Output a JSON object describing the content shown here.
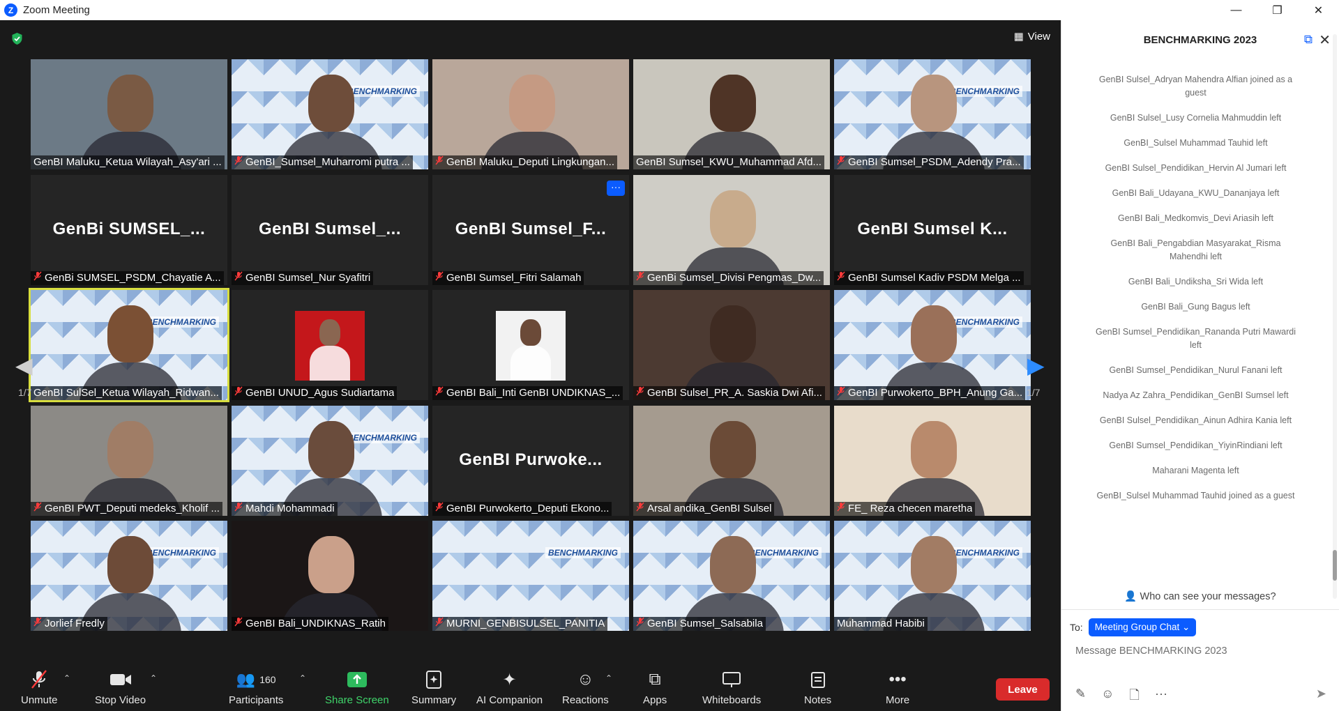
{
  "window": {
    "title": "Zoom Meeting",
    "minimize": "—",
    "restore": "❐",
    "close": "✕"
  },
  "view_label": "View",
  "pagination": {
    "left": "1/7",
    "right": "1/7"
  },
  "tiles": [
    {
      "name": "GenBI Maluku_Ketua Wilayah_Asy'ari ...",
      "muted": false,
      "kind": "video",
      "bg": "#6c7a86",
      "skin": "#7a5a44"
    },
    {
      "name": "GenBI_Sumsel_Muharromi putra ...",
      "muted": true,
      "kind": "banner",
      "skin": "#6e4d3a"
    },
    {
      "name": "GenBI Maluku_Deputi Lingkungan...",
      "muted": true,
      "kind": "video",
      "bg": "#b9a79a",
      "skin": "#c59a83"
    },
    {
      "name": "GenBI Sumsel_KWU_Muhammad Afd...",
      "muted": false,
      "kind": "video",
      "bg": "#c9c6bd",
      "skin": "#4f3426"
    },
    {
      "name": "GenBI Sumsel_PSDM_Adendy Pra...",
      "muted": true,
      "kind": "banner",
      "skin": "#b8957e"
    },
    {
      "name": "GenBi SUMSEL_PSDM_Chayatie A...",
      "muted": true,
      "kind": "name",
      "big": "GenBi  SUMSEL_..."
    },
    {
      "name": "GenBI Sumsel_Nur Syafitri",
      "muted": true,
      "kind": "name",
      "big": "GenBI  Sumsel_..."
    },
    {
      "name": "GenBI Sumsel_Fitri Salamah",
      "muted": true,
      "kind": "name",
      "big": "GenBI  Sumsel_F...",
      "dots": "···"
    },
    {
      "name": "GenBi Sumsel_Divisi Pengmas_Dw...",
      "muted": true,
      "kind": "video",
      "bg": "#cfcdc6",
      "skin": "#c8ab8c"
    },
    {
      "name": "GenBI Sumsel Kadiv PSDM Melga ...",
      "muted": true,
      "kind": "name",
      "big": "GenBI  Sumsel  K..."
    },
    {
      "name": "GenBI SulSel_Ketua Wilayah_Ridwan...",
      "muted": false,
      "kind": "banner",
      "skin": "#7b5034",
      "active": true
    },
    {
      "name": "GenBI UNUD_Agus Sudiartama",
      "muted": true,
      "kind": "photo",
      "bg": "#c4171b",
      "skin": "#8a6651"
    },
    {
      "name": "GenBI Bali_Inti GenBI UNDIKNAS_...",
      "muted": true,
      "kind": "photo",
      "bg": "#f2f2f2",
      "skin": "#6b4a38"
    },
    {
      "name": "GenBI Sulsel_PR_A. Saskia Dwi Afi...",
      "muted": true,
      "kind": "video",
      "bg": "#4c3a32",
      "skin": "#3f2b22"
    },
    {
      "name": "GenBI Purwokerto_BPH_Anung Ga...",
      "muted": true,
      "kind": "banner",
      "skin": "#9a7059"
    },
    {
      "name": "GenBI PWT_Deputi medeks_Kholif ...",
      "muted": true,
      "kind": "video",
      "bg": "#8c8a86",
      "skin": "#a07d66"
    },
    {
      "name": "Mahdi Mohammadi",
      "muted": true,
      "kind": "banner",
      "skin": "#6a4c3c"
    },
    {
      "name": "GenBI Purwokerto_Deputi Ekono...",
      "muted": true,
      "kind": "name",
      "big": "GenBI  Purwoke..."
    },
    {
      "name": "Arsal andika_GenBI Sulsel",
      "muted": true,
      "kind": "video",
      "bg": "#a59b8f",
      "skin": "#6b4b37"
    },
    {
      "name": "FE_ Reza checen maretha",
      "muted": true,
      "kind": "video",
      "bg": "#e8dccb",
      "skin": "#b98a6c"
    },
    {
      "name": "Jorlief Fredly",
      "muted": true,
      "kind": "banner",
      "skin": "#6d4b38"
    },
    {
      "name": "GenBI Bali_UNDIKNAS_Ratih",
      "muted": true,
      "kind": "video",
      "bg": "#1b1616",
      "skin": "#caa08a"
    },
    {
      "name": "MURNI_GENBISULSEL_PANITIA",
      "muted": true,
      "kind": "banner",
      "skin": null
    },
    {
      "name": "GenBI Sumsel_Salsabila",
      "muted": true,
      "kind": "banner",
      "skin": "#8d6a55"
    },
    {
      "name": "Muhammad Habibi",
      "muted": false,
      "kind": "banner",
      "skin": "#a27c64"
    }
  ],
  "banner_text": "BENCHMARKING",
  "toolbar": {
    "unmute": "Unmute",
    "stop_video": "Stop Video",
    "participants": "Participants",
    "participants_count": "160",
    "share_screen": "Share Screen",
    "summary": "Summary",
    "ai_companion": "AI Companion",
    "reactions": "Reactions",
    "apps": "Apps",
    "whiteboards": "Whiteboards",
    "notes": "Notes",
    "more": "More",
    "leave": "Leave"
  },
  "chat": {
    "title": "BENCHMARKING 2023",
    "messages": [
      "GenBI Sulsel_Adryan Mahendra Alfian joined as a guest",
      "GenBI Sulsel_Lusy Cornelia Mahmuddin left",
      "GenBI_Sulsel Muhammad Tauhid left",
      "GenBI Sulsel_Pendidikan_Hervin Al Jumari left",
      "GenBI Bali_Udayana_KWU_Dananjaya left",
      "GenBI Bali_Medkomvis_Devi Ariasih left",
      "GenBI Bali_Pengabdian Masyarakat_Risma Mahendhi left",
      "GenBI Bali_Undiksha_Sri Wida left",
      "GenBI Bali_Gung Bagus left",
      "GenBI Sumsel_Pendidikan_Rananda Putri Mawardi left",
      "GenBI Sumsel_Pendidikan_Nurul Fanani left",
      "Nadya Az Zahra_Pendidikan_GenBI Sumsel left",
      "GenBI Sulsel_Pendidikan_Ainun Adhira Kania left",
      "GenBI Sumsel_Pendidikan_YiyinRindiani left",
      "Maharani Magenta left",
      "GenBI_Sulsel Muhammad Tauhid joined as a guest"
    ],
    "who_can_see": "Who can see your messages?",
    "to_label": "To:",
    "recipient": "Meeting Group Chat",
    "placeholder": "Message BENCHMARKING 2023"
  }
}
